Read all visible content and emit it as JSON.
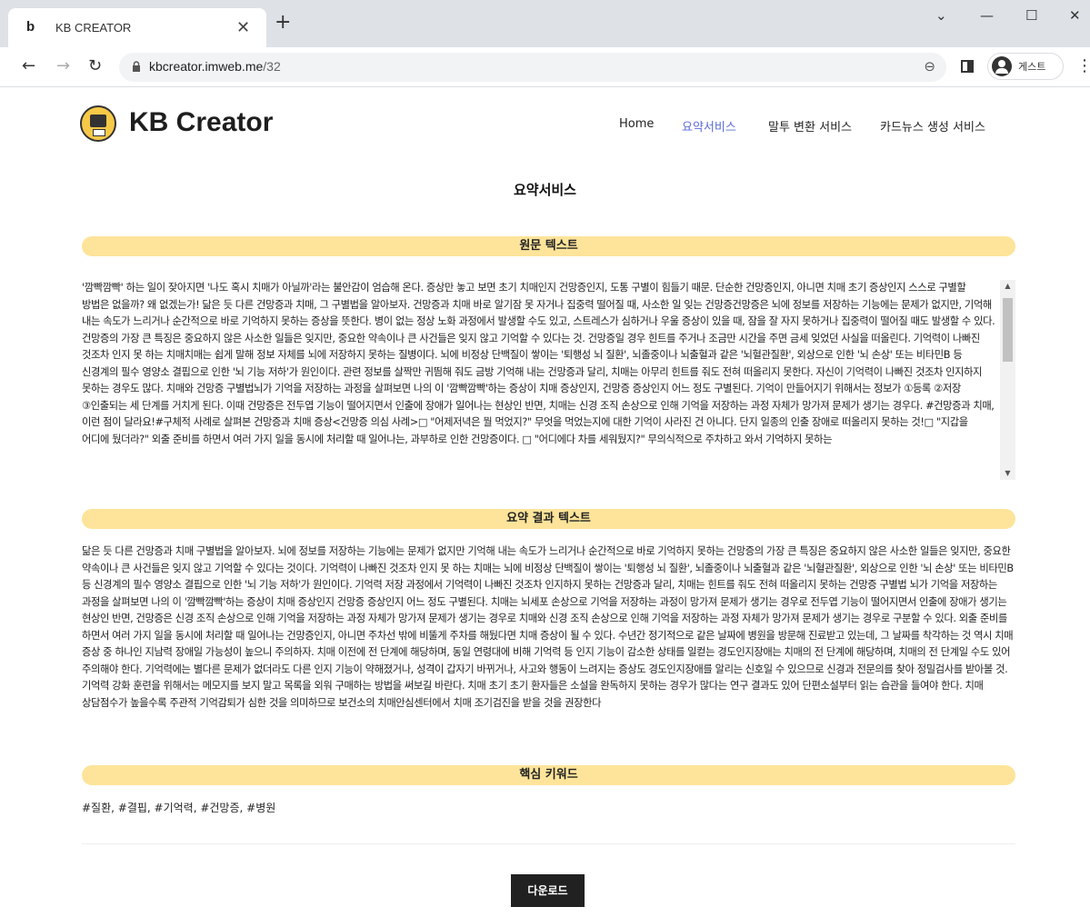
{
  "browser": {
    "tab_favicon": "b",
    "tab_title": "KB CREATOR",
    "url_host": "kbcreator.imweb.me",
    "url_path": "/32",
    "profile_label": "게스트"
  },
  "site": {
    "logo_text": "KB Creator",
    "nav": [
      "Home",
      "요약서비스",
      "말투 변환 서비스",
      "카드뉴스 생성 서비스"
    ],
    "active_nav": "요약서비스"
  },
  "page_title": "요약서비스",
  "sections": {
    "original_title": "원문 텍스트",
    "original_text": "'깜빡깜빡' 하는 일이 잦아지면 '나도 혹시 치매가 아닐까'라는 불안감이 엄습해 온다. 증상만 놓고 보면 초기 치매인지 건망증인지, 도통 구별이 힘들기 때문. 단순한 건망증인지, 아니면 치매 초기 증상인지 스스로 구별할 방법은 없을까? 왜 없겠는가! 닮은 듯 다른 건망증과 치매, 그 구별법을 알아보자. 건망증과 치매 바로 알기잠 못 자거나 집중력 떨어질 때, 사소한 일 잊는 건망증건망증은 뇌에 정보를 저장하는 기능에는 문제가 없지만, 기억해 내는 속도가 느리거나 순간적으로 바로 기억하지 못하는 증상을 뜻한다. 병이 없는 정상 노화 과정에서 발생할 수도 있고, 스트레스가 심하거나 우울 증상이 있을 때, 잠을 잘 자지 못하거나 집중력이 떨어질 때도 발생할 수 있다. 건망증의 가장 큰 특징은 중요하지 않은 사소한 일들은 잊지만, 중요한 약속이나 큰 사건들은 잊지 않고 기억할 수 있다는 것. 건망증일 경우 힌트를 주거나 조금만 시간을 주면 금세 잊었던 사실을 떠올린다. 기억력이 나빠진 것조차 인지 못 하는 치매치매는 쉽게 말해 정보 자체를 뇌에 저장하지 못하는 질병이다. 뇌에 비정상 단백질이 쌓이는 '퇴행성 뇌 질환', 뇌졸중이나 뇌출혈과 같은 '뇌혈관질환', 외상으로 인한 '뇌 손상' 또는 비타민B 등 신경계의 필수 영양소 결핍으로 인한 '뇌 기능 저하'가 원인이다. 관련 정보를 살짝만 귀띔해 줘도 금방 기억해 내는 건망증과 달리, 치매는 아무리 힌트를 줘도 전혀 떠올리지 못한다. 자신이 기억력이 나빠진 것조차 인지하지 못하는 경우도 많다. 치매와 건망증 구별법뇌가 기억을 저장하는 과정을 살펴보면 나의 이 '깜빡깜빡'하는 증상이 치매 증상인지, 건망증 증상인지 어느 정도 구별된다. 기억이 만들어지기 위해서는 정보가 ①등록 ②저장 ③인출되는 세 단계를 거치게 된다. 이때 건망증은 전두엽 기능이 떨어지면서 인출에 장애가 일어나는 현상인 반면, 치매는 신경 조직 손상으로 인해 기억을 저장하는 과정 자체가 망가져 문제가 생기는 경우다. #건망증과 치매, 이런 점이 달라요!#구체적 사례로 살펴본 건망증과 치매 증상<건망증 의심 사례>□ \"어제저녁은 뭘 먹었지?\" 무엇을 먹었는지에 대한 기억이 사라진 건 아니다. 단지 일종의 인출 장애로 떠올리지 못하는 것!□ \"지갑을 어디에 뒀더라?\" 외출 준비를 하면서 여러 가지 일을 동시에 처리할 때 일어나는, 과부하로 인한 건망증이다. □ \"어디에다 차를 세워뒀지?\" 무의식적으로 주차하고 와서 기억하지 못하는",
    "summary_title": "요약 결과 텍스트",
    "summary_text": "닮은 듯 다른 건망증과 치매 구별법을 알아보자. 뇌에 정보를 저장하는 기능에는 문제가 없지만 기억해 내는 속도가 느리거나 순간적으로 바로 기억하지 못하는 건망증의 가장 큰 특징은 중요하지 않은 사소한 일들은 잊지만, 중요한 약속이나 큰 사건들은 잊지 않고 기억할 수 있다는 것이다. 기억력이 나빠진 것조차 인지 못 하는 치매는 뇌에 비정상 단백질이 쌓이는 '퇴행성 뇌 질환', 뇌졸중이나 뇌출혈과 같은 '뇌혈관질환', 외상으로 인한 '뇌 손상' 또는 비타민B 등 신경계의 필수 영양소 결핍으로 인한 '뇌 기능 저하'가 원인이다. 기억력 저장 과정에서 기억력이 나빠진 것조차 인지하지 못하는 건망증과 달리, 치매는 힌트를 줘도 전혀 떠올리지 못하는 건망증 구별법 뇌가 기억을 저장하는 과정을 살펴보면 나의 이 '깜빡깜빡'하는 증상이 치매 증상인지 건망증 증상인지 어느 정도 구별된다. 치매는 뇌세포 손상으로 기억을 저장하는 과정이 망가져 문제가 생기는 경우로 전두엽 기능이 떨어지면서 인출에 장애가 생기는 현상인 반면, 건망증은 신경 조직 손상으로 인해 기억을 저장하는 과정 자체가 망가져 문제가 생기는 경우로 치매와 신경 조직 손상으로 인해 기억을 저장하는 과정 자체가 망가져 문제가 생기는 경우로 구분할 수 있다. 외출 준비를 하면서 여러 가지 일을 동시에 처리할 때 일어나는 건망증인지, 아니면 주차선 밖에 비뚤게 주차를 해뒀다면 치매 증상이 될 수 있다. 수년간 정기적으로 같은 날짜에 병원을 방문해 진료받고 있는데, 그 날짜를 착각하는 것 역시 치매 증상 중 하나인 지남력 장애일 가능성이 높으니 주의하자. 치매 이전에 전 단계에 해당하며, 동일 연령대에 비해 기억력 등 인지 기능이 감소한 상태를 일컫는 경도인지장애는 치매의 전 단계에 해당하며, 치매의 전 단계일 수도 있어 주의해야 한다. 기억력에는 별다른 문제가 없더라도 다른 인지 기능이 약해졌거나, 성격이 갑자기 바뀌거나, 사고와 행동이 느려지는 증상도 경도인지장애를 알리는 신호일 수 있으므로 신경과 전문의를 찾아 정밀검사를 받아볼 것. 기억력 강화 훈련을 위해서는 메모지를 보지 말고 목록을 외워 구매하는 방법을 써보길 바란다. 치매 초기 초기 환자들은 소설을 완독하지 못하는 경우가 많다는 연구 결과도 있어 단편소설부터 읽는 습관을 들여야 한다. 치매 상담점수가 높을수록 주관적 기억감퇴가 심한 것을 의미하므로 보건소의 치매안심센터에서 치매 조기검진을 받을 것을 권장한다",
    "keywords_title": "핵심 키워드",
    "keywords_text": "#질환, #결핍, #기억력, #건망증, #병원"
  },
  "download_label": "다운로드"
}
